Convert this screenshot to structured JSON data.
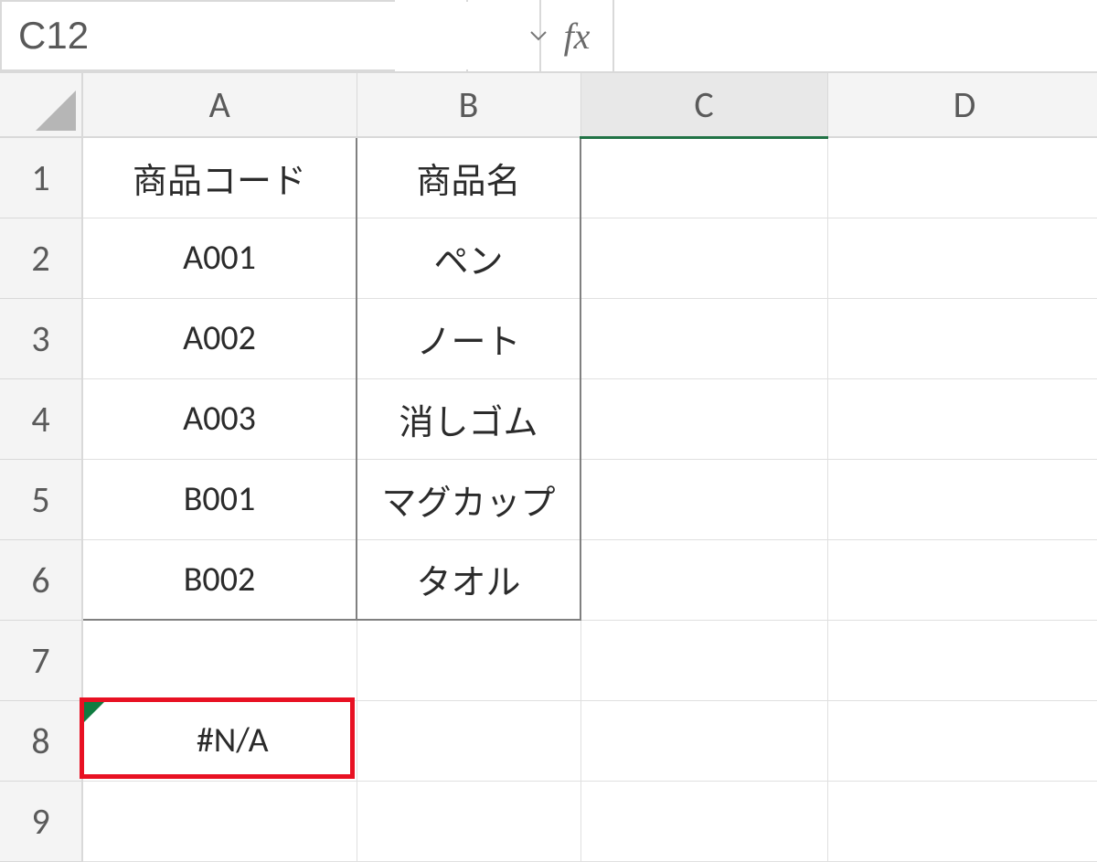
{
  "nameBox": {
    "value": "C12"
  },
  "formulaBar": {
    "value": "",
    "fxLabel": "fx"
  },
  "columns": [
    "A",
    "B",
    "C",
    "D"
  ],
  "rows": [
    "1",
    "2",
    "3",
    "4",
    "5",
    "6",
    "7",
    "8",
    "9"
  ],
  "selectedColumn": "C",
  "cells": {
    "A1": "商品コード",
    "B1": "商品名",
    "A2": "A001",
    "B2": "ペン",
    "A3": "A002",
    "B3": "ノート",
    "A4": "A003",
    "B4": "消しゴム",
    "A5": "B001",
    "B5": "マグカップ",
    "A6": "B002",
    "B6": "タオル",
    "A8": "#N/A"
  },
  "highlightCell": "A8"
}
